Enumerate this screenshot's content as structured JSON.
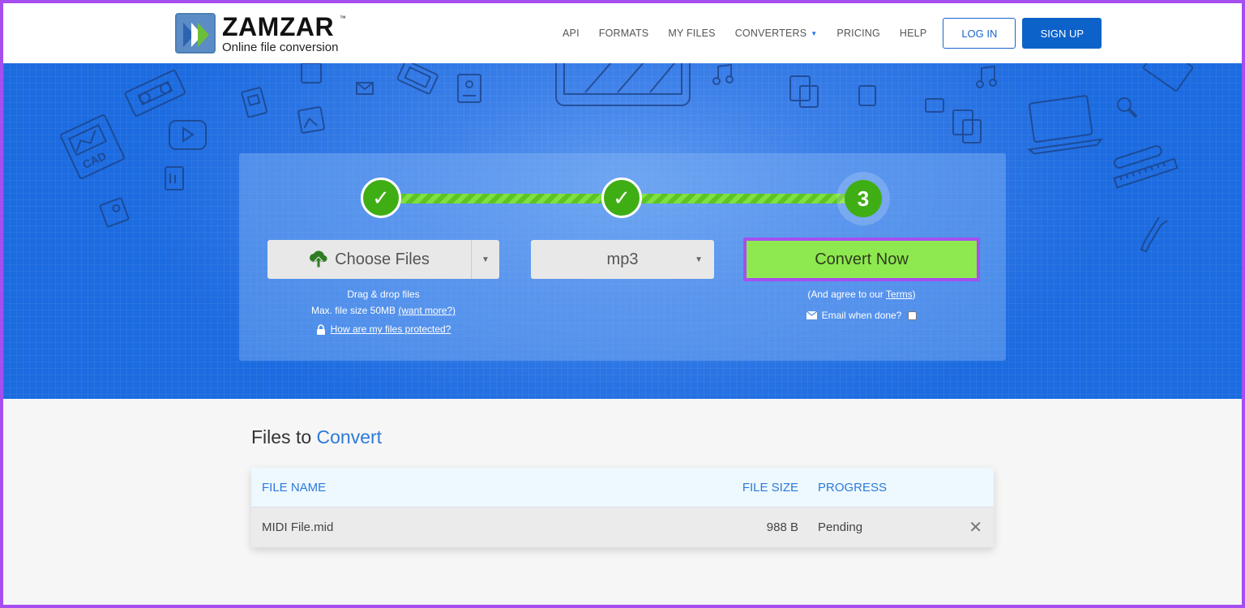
{
  "header": {
    "logo_title": "ZAMZAR",
    "logo_tm": "™",
    "logo_subtitle": "Online file conversion",
    "nav": [
      {
        "label": "API"
      },
      {
        "label": "FORMATS"
      },
      {
        "label": "MY FILES"
      },
      {
        "label": "CONVERTERS",
        "has_dropdown": true
      },
      {
        "label": "PRICING"
      },
      {
        "label": "HELP"
      }
    ],
    "login_label": "LOG IN",
    "signup_label": "SIGN UP"
  },
  "converter": {
    "steps": [
      {
        "state": "done",
        "glyph": "✓"
      },
      {
        "state": "done",
        "glyph": "✓"
      },
      {
        "state": "current",
        "glyph": "3"
      }
    ],
    "choose_files_label": "Choose Files",
    "format_selected": "mp3",
    "convert_label": "Convert Now",
    "drag_drop_text": "Drag & drop files",
    "max_size_text": "Max. file size 50MB",
    "want_more_link": "(want more?)",
    "protected_link": "How are my files protected?",
    "agree_prefix": "(And agree to our ",
    "terms_link": "Terms",
    "agree_suffix": ")",
    "email_label": "Email when done?",
    "email_checked": false
  },
  "files": {
    "title_prefix": "Files to",
    "title_accent": "Convert",
    "columns": [
      "FILE NAME",
      "FILE SIZE",
      "PROGRESS"
    ],
    "rows": [
      {
        "name": "MIDI File.mid",
        "size": "988 B",
        "progress": "Pending"
      }
    ],
    "remove_glyph": "✕"
  },
  "colors": {
    "brand_blue": "#0d62c9",
    "hero_blue": "#1c6be0",
    "convert_green": "#8ee84f",
    "step_green": "#3fae14",
    "highlight_purple": "#a64ff0",
    "accent_text": "#2d7ad6"
  }
}
